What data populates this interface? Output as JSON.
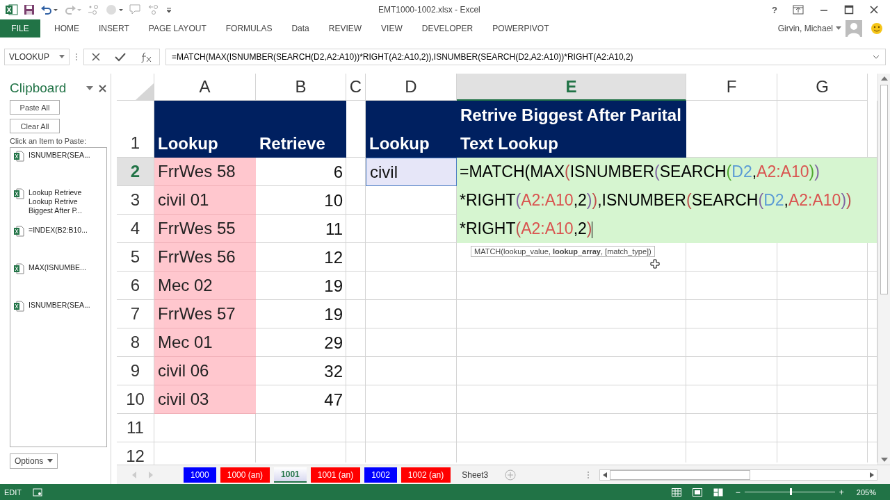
{
  "window": {
    "title": "EMT1000-1002.xlsx - Excel",
    "help": "?"
  },
  "ribbon": {
    "tabs": [
      {
        "label": "FILE",
        "selected": false,
        "kind": "file"
      },
      {
        "label": "HOME",
        "selected": false,
        "kind": "tab"
      },
      {
        "label": "INSERT",
        "selected": false,
        "kind": "tab"
      },
      {
        "label": "PAGE LAYOUT",
        "selected": false,
        "kind": "tab"
      },
      {
        "label": "FORMULAS",
        "selected": false,
        "kind": "tab"
      },
      {
        "label": "Data",
        "selected": false,
        "kind": "tab"
      },
      {
        "label": "REVIEW",
        "selected": false,
        "kind": "tab"
      },
      {
        "label": "VIEW",
        "selected": false,
        "kind": "tab"
      },
      {
        "label": "DEVELOPER",
        "selected": false,
        "kind": "tab"
      },
      {
        "label": "POWERPIVOT",
        "selected": false,
        "kind": "tab"
      }
    ],
    "user": "Girvin, Michael"
  },
  "formula_bar": {
    "name_box": "VLOOKUP",
    "formula": "=MATCH(MAX(ISNUMBER(SEARCH(D2,A2:A10))*RIGHT(A2:A10,2)),ISNUMBER(SEARCH(D2,A2:A10))*RIGHT(A2:A10,2)"
  },
  "clipboard": {
    "title": "Clipboard",
    "buttons": [
      "Paste All",
      "Clear All"
    ],
    "hint": "Click an Item to Paste:",
    "items": [
      "ISNUMBER(SEA...",
      "Lookup Retrieve\nLookup Retrive\nBiggest After P...",
      "=INDEX(B2:B10...",
      "MAX(ISNUMBE...",
      "ISNUMBER(SEA..."
    ],
    "options": "Options"
  },
  "sheet": {
    "columns": [
      {
        "letter": "A",
        "selected": false
      },
      {
        "letter": "B",
        "selected": false
      },
      {
        "letter": "C",
        "selected": false
      },
      {
        "letter": "D",
        "selected": false
      },
      {
        "letter": "E",
        "selected": true
      },
      {
        "letter": "F",
        "selected": false
      },
      {
        "letter": "G",
        "selected": false
      }
    ],
    "rows": [
      {
        "number": "1",
        "selected": false,
        "kind": "header",
        "a": "Lookup",
        "b": "Retrieve",
        "d": "Lookup",
        "e": "Retrive Biggest After Parital Text Lookup"
      },
      {
        "number": "2",
        "selected": true,
        "kind": "data",
        "a": "FrrWes 58",
        "b": "6",
        "d": "civil",
        "highlighted": true
      },
      {
        "number": "3",
        "selected": false,
        "kind": "data",
        "a": "civil 01",
        "b": "10",
        "highlighted": true
      },
      {
        "number": "4",
        "selected": false,
        "kind": "data",
        "a": "FrrWes 55",
        "b": "11",
        "highlighted": true
      },
      {
        "number": "5",
        "selected": false,
        "kind": "data",
        "a": "FrrWes 56",
        "b": "12",
        "highlighted": true
      },
      {
        "number": "6",
        "selected": false,
        "kind": "data",
        "a": "Mec 02",
        "b": "19",
        "highlighted": true
      },
      {
        "number": "7",
        "selected": false,
        "kind": "data",
        "a": "FrrWes 57",
        "b": "19",
        "highlighted": true
      },
      {
        "number": "8",
        "selected": false,
        "kind": "data",
        "a": "Mec 01",
        "b": "29",
        "highlighted": true
      },
      {
        "number": "9",
        "selected": false,
        "kind": "data",
        "a": "civil 06",
        "b": "32",
        "highlighted": true
      },
      {
        "number": "10",
        "selected": false,
        "kind": "data",
        "a": "civil 03",
        "b": "47",
        "highlighted": true
      },
      {
        "number": "11",
        "selected": false,
        "kind": "empty"
      },
      {
        "number": "12",
        "selected": false,
        "kind": "empty"
      }
    ],
    "editor": {
      "segments": [
        {
          "text": "=MATCH(MAX",
          "color": "#000000"
        },
        {
          "text": "(",
          "color": "#c0504d"
        },
        {
          "text": "ISNUMBER",
          "color": "#000000"
        },
        {
          "text": "(",
          "color": "#8064a2"
        },
        {
          "text": "SEARCH",
          "color": "#000000"
        },
        {
          "text": "(",
          "color": "#4ea72e"
        },
        {
          "text": "D2",
          "color": "#5b9bd5"
        },
        {
          "text": ",",
          "color": "#000000"
        },
        {
          "text": "A2:A10",
          "color": "#d9534f"
        },
        {
          "text": ")",
          "color": "#4ea72e"
        },
        {
          "text": ")",
          "color": "#8064a2"
        },
        {
          "text": "*RIGHT",
          "color": "#000000"
        },
        {
          "text": "(",
          "color": "#8064a2"
        },
        {
          "text": "A2:A10",
          "color": "#d9534f"
        },
        {
          "text": ",2",
          "color": "#000000"
        },
        {
          "text": ")",
          "color": "#8064a2"
        },
        {
          "text": ")",
          "color": "#c0504d"
        },
        {
          "text": ",ISNUMBER",
          "color": "#000000"
        },
        {
          "text": "(",
          "color": "#c0504d"
        },
        {
          "text": "SEARCH",
          "color": "#000000"
        },
        {
          "text": "(",
          "color": "#8064a2"
        },
        {
          "text": "D2",
          "color": "#5b9bd5"
        },
        {
          "text": ",",
          "color": "#000000"
        },
        {
          "text": "A2:A10",
          "color": "#d9534f"
        },
        {
          "text": ")",
          "color": "#8064a2"
        },
        {
          "text": ")",
          "color": "#c0504d"
        },
        {
          "text": "*RIGHT",
          "color": "#000000"
        },
        {
          "text": "(",
          "color": "#c0504d"
        },
        {
          "text": "A2:A10",
          "color": "#d9534f"
        },
        {
          "text": ",2",
          "color": "#000000"
        },
        {
          "text": ")",
          "color": "#c0504d"
        }
      ],
      "tooltip": "MATCH(lookup_value, **lookup_array**, [match_type])"
    }
  },
  "sheet_tabs": [
    {
      "label": "1000",
      "selected": false,
      "color": "#0000ff"
    },
    {
      "label": "1000 (an)",
      "selected": false,
      "color": "#ff0000"
    },
    {
      "label": "1001",
      "selected": true
    },
    {
      "label": "1001 (an)",
      "selected": false,
      "color": "#ff0000"
    },
    {
      "label": "1002",
      "selected": false,
      "color": "#0000ff"
    },
    {
      "label": "1002 (an)",
      "selected": false,
      "color": "#ff0000"
    },
    {
      "label": "Sheet3",
      "selected": false
    }
  ],
  "status_bar": {
    "mode": "EDIT",
    "zoom_out": "−",
    "zoom_in": "+",
    "zoom": "205%",
    "level": 0.5
  }
}
